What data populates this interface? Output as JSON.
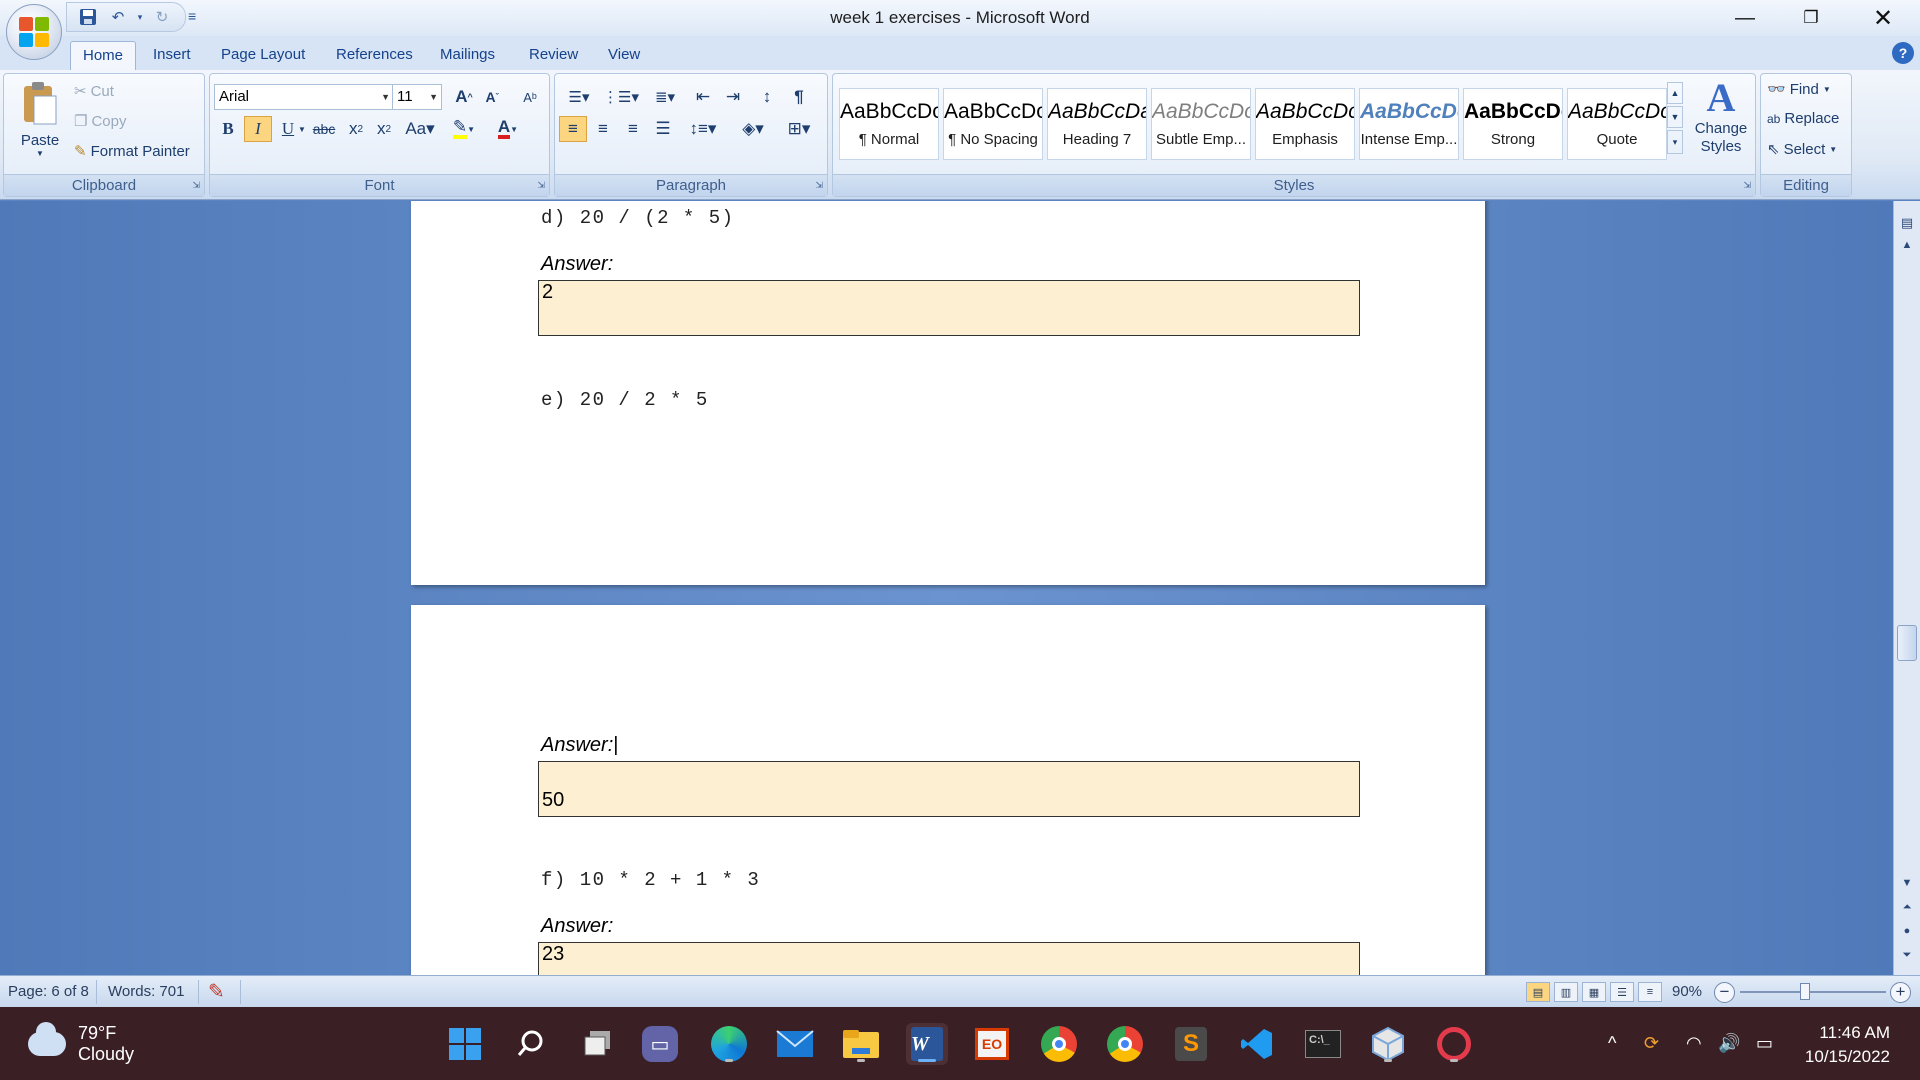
{
  "window": {
    "title": "week 1 exercises - Microsoft Word"
  },
  "tabs": [
    "Home",
    "Insert",
    "Page Layout",
    "References",
    "Mailings",
    "Review",
    "View"
  ],
  "ribbon": {
    "clipboard": {
      "label": "Clipboard",
      "paste": "Paste",
      "cut": "Cut",
      "copy": "Copy",
      "format_painter": "Format Painter"
    },
    "font": {
      "label": "Font",
      "font_name": "Arial",
      "font_size": "11"
    },
    "paragraph": {
      "label": "Paragraph"
    },
    "styles": {
      "label": "Styles",
      "items": [
        {
          "sample": "AaBbCcDc",
          "name": "¶ Normal",
          "style": "normal"
        },
        {
          "sample": "AaBbCcDc",
          "name": "¶ No Spacing",
          "style": "normal"
        },
        {
          "sample": "AaBbCcDa",
          "name": "Heading 7",
          "style": "italic"
        },
        {
          "sample": "AaBbCcDc",
          "name": "Subtle Emp...",
          "style": "subtle"
        },
        {
          "sample": "AaBbCcDc",
          "name": "Emphasis",
          "style": "italic"
        },
        {
          "sample": "AaBbCcDc",
          "name": "Intense Emp...",
          "style": "intense"
        },
        {
          "sample": "AaBbCcDc",
          "name": "Strong",
          "style": "bold"
        },
        {
          "sample": "AaBbCcDc",
          "name": "Quote",
          "style": "italic"
        }
      ],
      "change_styles": "Change Styles"
    },
    "editing": {
      "label": "Editing",
      "find": "Find",
      "replace": "Replace",
      "select": "Select"
    }
  },
  "document": {
    "page1": {
      "q_d": "d) 20 / (2 * 5)",
      "answer_label_d": "Answer:",
      "answer_d": "2",
      "q_e": "e) 20 / 2 * 5"
    },
    "page2": {
      "answer_label_e": "Answer:",
      "answer_e": "50",
      "q_f": "f) 10 * 2 + 1 * 3",
      "answer_label_f": "Answer:",
      "answer_f": "23"
    }
  },
  "statusbar": {
    "page": "Page: 6 of 8",
    "words": "Words: 701",
    "zoom": "90%"
  },
  "taskbar": {
    "weather_temp": "79°F",
    "weather_cond": "Cloudy",
    "time": "11:46 AM",
    "date": "10/15/2022"
  },
  "colors": {
    "answer_box": "#fdefd1",
    "ribbon_text": "#15428b",
    "taskbar": "#3a1f24"
  }
}
